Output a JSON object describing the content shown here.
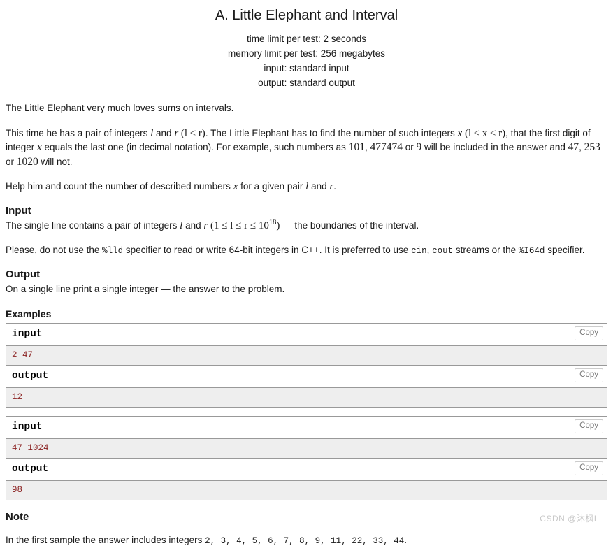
{
  "problem": {
    "title": "A. Little Elephant and Interval",
    "limits": [
      "time limit per test: 2 seconds",
      "memory limit per test: 256 megabytes",
      "input: standard input",
      "output: standard output"
    ]
  },
  "statement": {
    "p1": "The Little Elephant very much loves sums on intervals.",
    "p2_a": "This time he has a pair of integers ",
    "p2_var_l": "l",
    "p2_b": " and ",
    "p2_var_r": "r",
    "p2_cond": "(l ≤ r)",
    "p2_c": ". The Little Elephant has to find the number of such integers ",
    "p2_var_x": "x",
    "p2_cond2": "(l ≤ x ≤ r)",
    "p2_d": ", that the first digit of integer ",
    "p2_var_x2": "x",
    "p2_e": " equals the last one (in decimal notation). For example, such numbers as ",
    "p2_num1": "101",
    "p2_f": ", ",
    "p2_num2": "477474",
    "p2_g": " or ",
    "p2_num3": "9",
    "p2_h": " will be included in the answer and ",
    "p2_num4": "47",
    "p2_i": ", ",
    "p2_num5": "253",
    "p2_j": " or ",
    "p2_num6": "1020",
    "p2_k": " will not.",
    "p3_a": "Help him and count the number of described numbers ",
    "p3_var_x": "x",
    "p3_b": " for a given pair ",
    "p3_var_l": "l",
    "p3_c": " and ",
    "p3_var_r": "r",
    "p3_d": "."
  },
  "input_section": {
    "heading": "Input",
    "line_a": "The single line contains a pair of integers ",
    "var_l": "l",
    "line_b": " and ",
    "var_r": "r",
    "constraint_open": "(1 ≤ l ≤ r ≤ 10",
    "constraint_exp": "18",
    "constraint_close": ")",
    "line_c": " — the boundaries of the interval.",
    "note_a": "Please, do not use the ",
    "note_code1": "%lld",
    "note_b": " specifier to read or write 64-bit integers in C++. It is preferred to use ",
    "note_code2": "cin",
    "note_c": ", ",
    "note_code3": "cout",
    "note_d": " streams or the ",
    "note_code4": "%I64d",
    "note_e": " specifier."
  },
  "output_section": {
    "heading": "Output",
    "body": "On a single line print a single integer — the answer to the problem."
  },
  "examples": {
    "heading": "Examples",
    "copy_label": "Copy",
    "tests": [
      {
        "input_label": "input",
        "input_data": "2 47",
        "output_label": "output",
        "output_data": "12"
      },
      {
        "input_label": "input",
        "input_data": "47 1024",
        "output_label": "output",
        "output_data": "98"
      }
    ]
  },
  "note_section": {
    "heading": "Note",
    "text_a": "In the first sample the answer includes integers ",
    "numbers": "2,  3,  4,  5,  6,  7,  8,  9,  11,  22,  33,  44",
    "text_b": "."
  },
  "watermark": "CSDN @沐枫L"
}
